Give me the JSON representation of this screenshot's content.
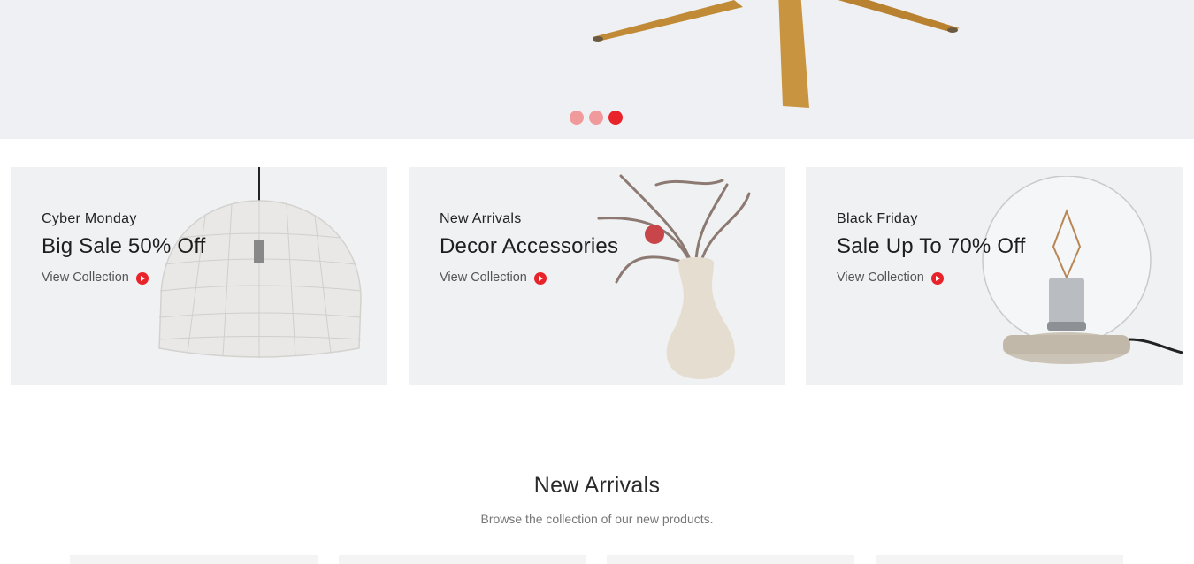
{
  "hero": {
    "image": "wooden-chair-legs-photo",
    "dots": [
      {
        "label": "slide-1",
        "active": false
      },
      {
        "label": "slide-2",
        "active": false
      },
      {
        "label": "slide-3",
        "active": true
      }
    ]
  },
  "banners": [
    {
      "eyebrow": "Cyber Monday",
      "headline": "Big Sale 50% Off",
      "cta": "View Collection",
      "image": "wire-pendant-lamp"
    },
    {
      "eyebrow": "New Arrivals",
      "headline": "Decor Accessories",
      "cta": "View Collection",
      "image": "vase-with-branches"
    },
    {
      "eyebrow": "Black Friday",
      "headline": "Sale Up To 70% Off",
      "cta": "View Collection",
      "image": "glass-globe-lamp"
    }
  ],
  "section": {
    "title": "New Arrivals",
    "subtitle": "Browse the collection of our new products."
  },
  "colors": {
    "accent": "#e8232a",
    "accent_light": "#f09a9c",
    "panel": "#f0f1f3"
  }
}
